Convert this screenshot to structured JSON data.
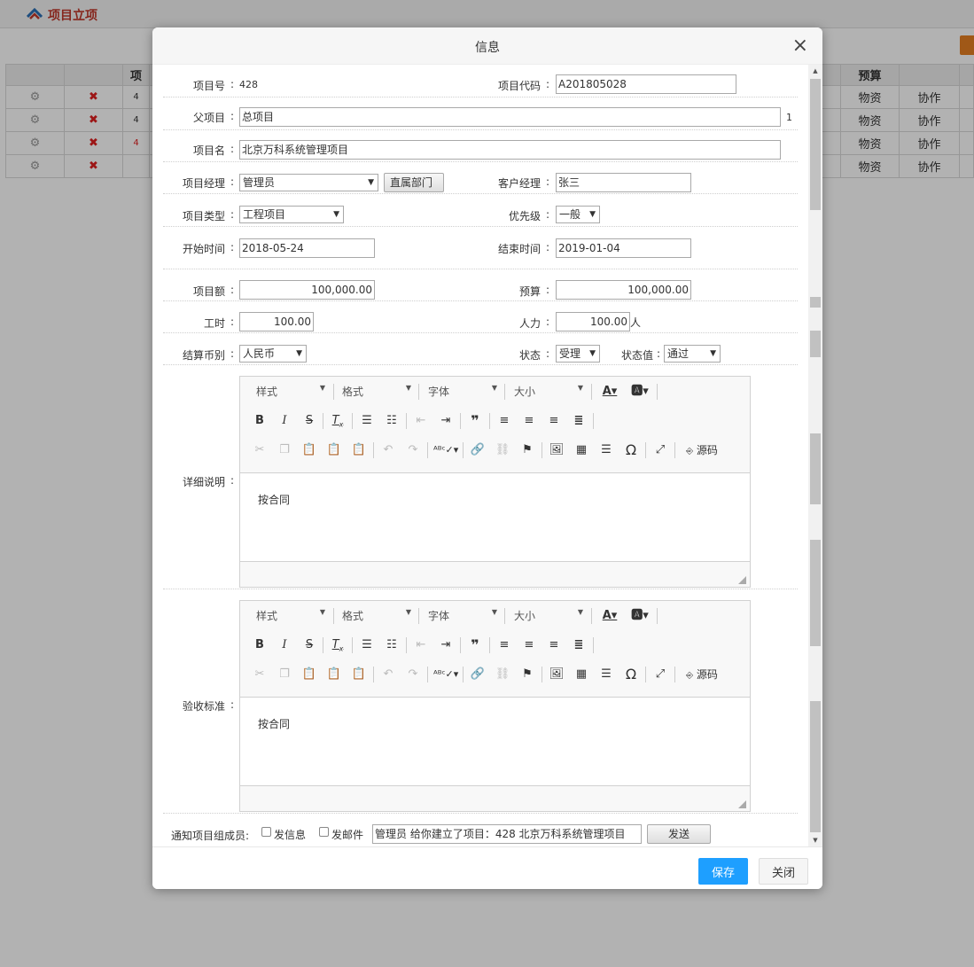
{
  "page": {
    "title": "项目立项",
    "table": {
      "header": [
        "项",
        "预算"
      ],
      "row_cells": [
        "物资",
        "协作"
      ],
      "row_ids": [
        "4",
        "4",
        "4",
        ""
      ]
    }
  },
  "dialog": {
    "title": "信息",
    "close_glyph": "×",
    "fields": {
      "project_no_label": "项目号",
      "project_no": "428",
      "project_code_label": "项目代码",
      "project_code": "A201805028",
      "parent_label": "父项目",
      "parent": "总项目",
      "parent_suffix": "1",
      "name_label": "项目名",
      "name": "北京万科系统管理项目",
      "manager_label": "项目经理",
      "manager": "管理员",
      "dept_button": "直属部门",
      "client_mgr_label": "客户经理",
      "client_mgr": "张三",
      "type_label": "项目类型",
      "type": "工程项目",
      "priority_label": "优先级",
      "priority": "一般",
      "start_label": "开始时间",
      "start": "2018-05-24",
      "end_label": "结束时间",
      "end": "2019-01-04",
      "amount_label": "项目额",
      "amount": "100,000.00",
      "budget_label": "预算",
      "budget": "100,000.00",
      "hours_label": "工时",
      "hours": "100.00",
      "manpower_label": "人力",
      "manpower": "100.00",
      "manpower_unit": "人",
      "currency_label": "结算币别",
      "currency": "人民币",
      "status_label": "状态",
      "status": "受理",
      "status_value_label": "状态值",
      "status_value": "通过",
      "detail_label": "详细说明",
      "detail_text": "按合同",
      "acceptance_label": "验收标准",
      "acceptance_text": "按合同"
    },
    "editor": {
      "style": "样式",
      "format": "格式",
      "font": "字体",
      "size": "大小",
      "source": "源码"
    },
    "notify": {
      "label": "通知项目组成员:",
      "msg_label": "发信息",
      "mail_label": "发邮件",
      "message": "管理员 给你建立了项目：428 北京万科系统管理项目",
      "send_button": "发送"
    },
    "save_button": "保存",
    "close_button": "关闭"
  }
}
